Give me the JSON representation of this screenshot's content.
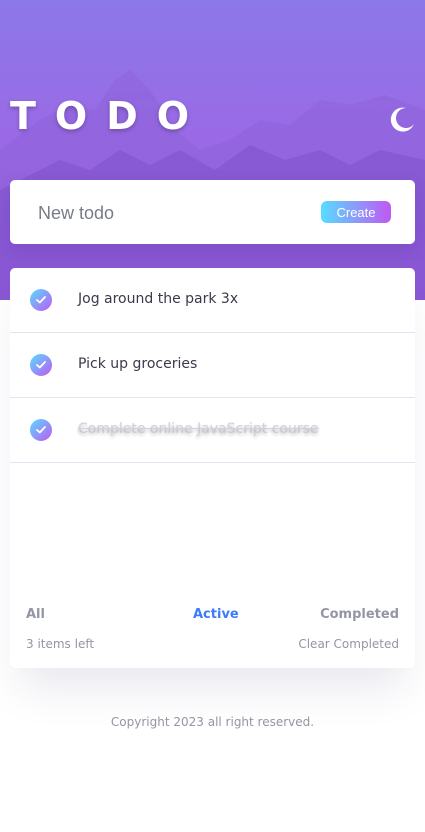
{
  "header": {
    "title": "TODO",
    "theme_icon": "moon-icon"
  },
  "new_todo": {
    "placeholder": "New todo",
    "value": "",
    "create_label": "Create"
  },
  "todos": [
    {
      "text": "Jog around the park 3x",
      "completed": false
    },
    {
      "text": "Pick up groceries",
      "completed": false
    },
    {
      "text": "Complete online JavaScript course",
      "completed": true
    }
  ],
  "footer": {
    "filters": [
      "All",
      "Active",
      "Completed"
    ],
    "active_filter": "Active",
    "items_left": "3 items left",
    "clear_label": "Clear Completed"
  },
  "copyright": "Copyright 2023 all right reserved.",
  "colors": {
    "accent": "#3a7cfd",
    "gradient_start": "#57ddff",
    "gradient_end": "#c058f3",
    "hero": "#9a6ae6"
  }
}
